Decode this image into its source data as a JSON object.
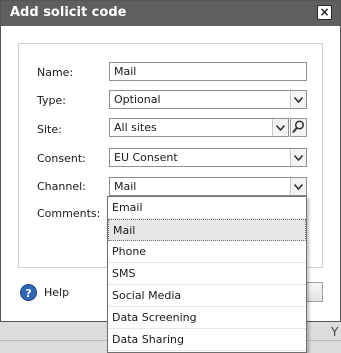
{
  "dialog": {
    "title": "Add solicit code",
    "close_symbol": "×"
  },
  "form": {
    "name": {
      "label": "Name:",
      "value": "Mail"
    },
    "type": {
      "label": "Type:",
      "value": "Optional"
    },
    "site": {
      "label": "Site:",
      "value": "All sites"
    },
    "consent": {
      "label": "Consent:",
      "value": "EU Consent"
    },
    "channel": {
      "label": "Channel:",
      "value": "Mail"
    },
    "comments": {
      "label": "Comments:"
    }
  },
  "channel_options": [
    "Email",
    "Mail",
    "Phone",
    "SMS",
    "Social Media",
    "Data Screening",
    "Data Sharing"
  ],
  "channel_selected_index": 1,
  "footer": {
    "help_label": "Help",
    "help_symbol": "?"
  },
  "background": {
    "glyph": "Y"
  },
  "icons": {
    "close": "close-icon",
    "dropdown": "chevron-down-icon",
    "search": "search-icon",
    "help": "help-icon"
  }
}
